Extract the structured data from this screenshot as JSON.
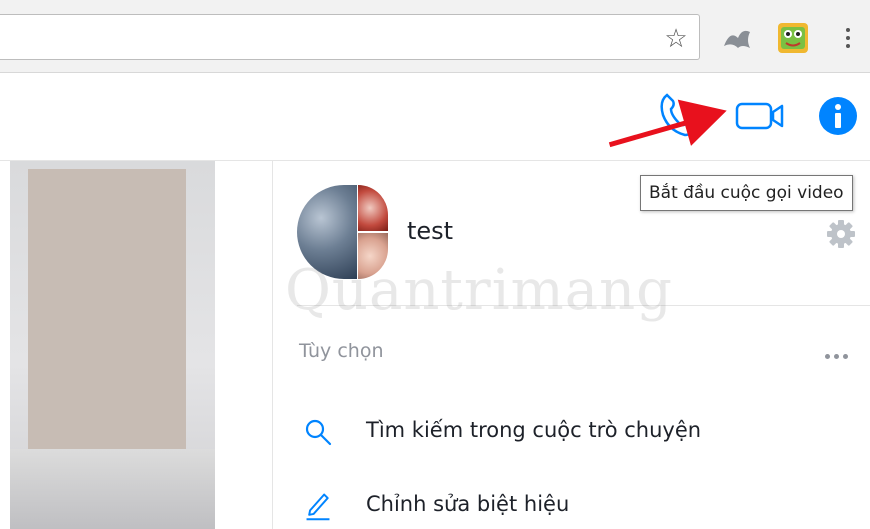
{
  "browser": {
    "address_value": "",
    "icons": [
      "star-icon",
      "extension-icon",
      "extension-frog-icon",
      "menu-dots-icon"
    ]
  },
  "header": {
    "icons": [
      "phone-icon",
      "video-call-icon",
      "info-icon"
    ],
    "accent_color": "#0084ff"
  },
  "tooltip": {
    "text": "Bắt đầu cuộc gọi video"
  },
  "conversation": {
    "name": "test"
  },
  "options": {
    "label": "Tùy chọn",
    "items": [
      {
        "label": "Tìm kiếm trong cuộc trò chuyện",
        "icon": "search-icon"
      },
      {
        "label": "Chỉnh sửa biệt hiệu",
        "icon": "pencil-icon"
      }
    ]
  },
  "watermark": {
    "text": "Quantrimang"
  },
  "annotation": {
    "color": "#e8111d",
    "icon": "red-arrow-icon"
  }
}
